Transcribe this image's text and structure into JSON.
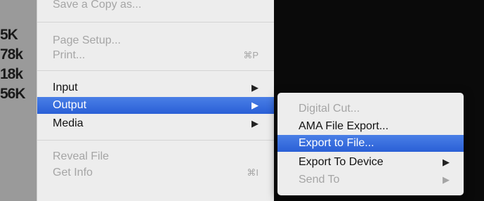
{
  "background": {
    "sizes": [
      "5K",
      "78k",
      "18k",
      "56K"
    ]
  },
  "file_menu": {
    "items": [
      {
        "label": "Save a Copy as...",
        "shortcut": "",
        "disabled": true
      },
      {
        "label": "Page Setup...",
        "shortcut": "",
        "disabled": true
      },
      {
        "label": "Print...",
        "shortcut": "⌘P",
        "disabled": true
      },
      {
        "label": "Input",
        "submenu_arrow": "▶",
        "disabled": false
      },
      {
        "label": "Output",
        "submenu_arrow": "▶",
        "disabled": false,
        "highlighted": true
      },
      {
        "label": "Media",
        "submenu_arrow": "▶",
        "disabled": false
      },
      {
        "label": "Reveal File",
        "shortcut": "",
        "disabled": true
      },
      {
        "label": "Get Info",
        "shortcut": "⌘I",
        "disabled": true
      }
    ]
  },
  "output_submenu": {
    "items": [
      {
        "label": "Digital Cut...",
        "disabled": true
      },
      {
        "label": "AMA File Export...",
        "disabled": false
      },
      {
        "label": "Export to File...",
        "disabled": false,
        "highlighted": true
      },
      {
        "label": "Export To Device",
        "submenu_arrow": "▶",
        "disabled": false
      },
      {
        "label": "Send To",
        "submenu_arrow": "▶",
        "disabled": true
      }
    ]
  },
  "colors": {
    "highlight": "#2f66db",
    "menu_bg": "#ededed",
    "disabled_text": "#a5a5a5"
  }
}
